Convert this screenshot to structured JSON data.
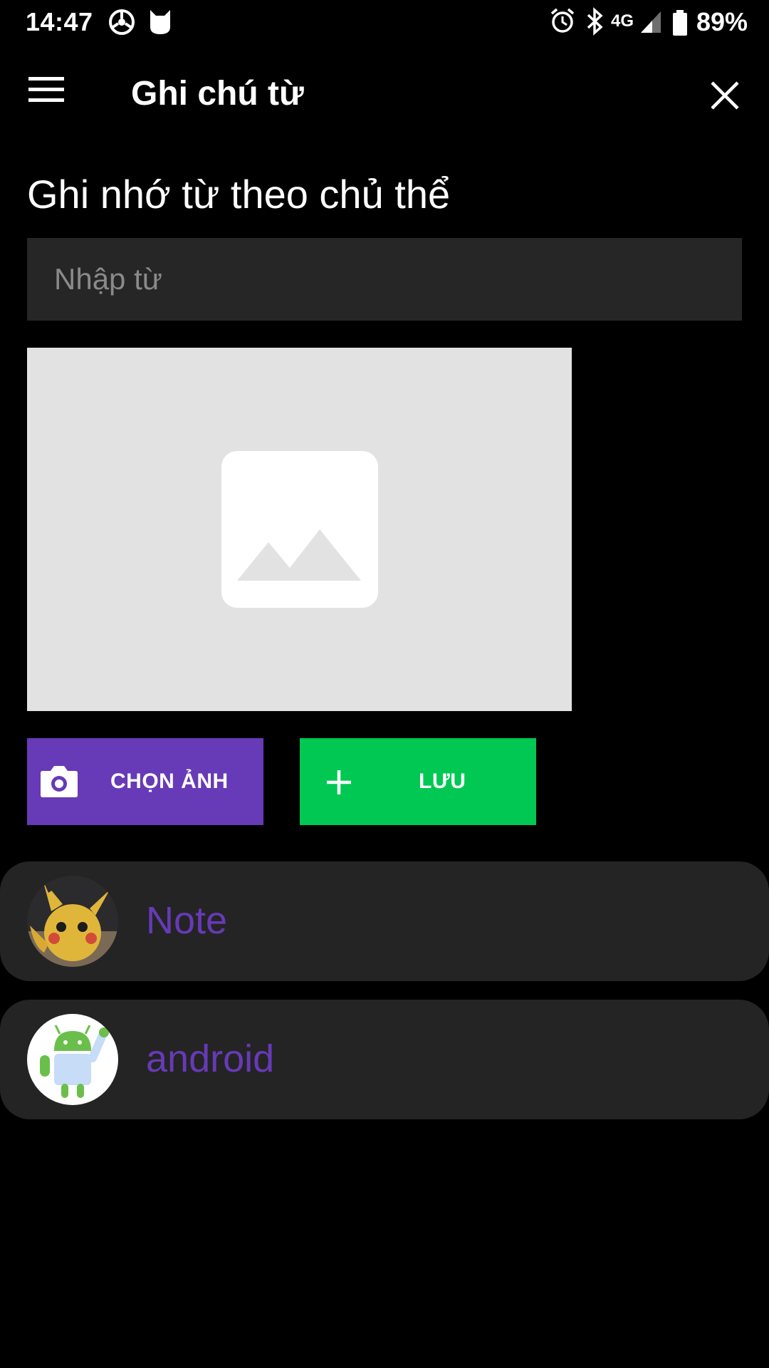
{
  "status_bar": {
    "time": "14:47",
    "network": "4G",
    "battery": "89%",
    "icons": [
      "steering-icon",
      "cat-icon",
      "alarm-icon",
      "bluetooth-icon",
      "signal-icon",
      "battery-icon"
    ]
  },
  "app_bar": {
    "title": "Ghi chú từ"
  },
  "form": {
    "heading": "Ghi nhớ từ theo chủ thể",
    "input_placeholder": "Nhập từ",
    "input_value": ""
  },
  "buttons": {
    "choose_image": "CHỌN ẢNH",
    "save": "LƯU"
  },
  "list": [
    {
      "label": "Note"
    },
    {
      "label": "android"
    }
  ],
  "colors": {
    "background": "#000000",
    "surface": "#262626",
    "accent_purple": "#673ab7",
    "accent_green": "#00c853",
    "placeholder_bg": "#e2e2e2"
  }
}
